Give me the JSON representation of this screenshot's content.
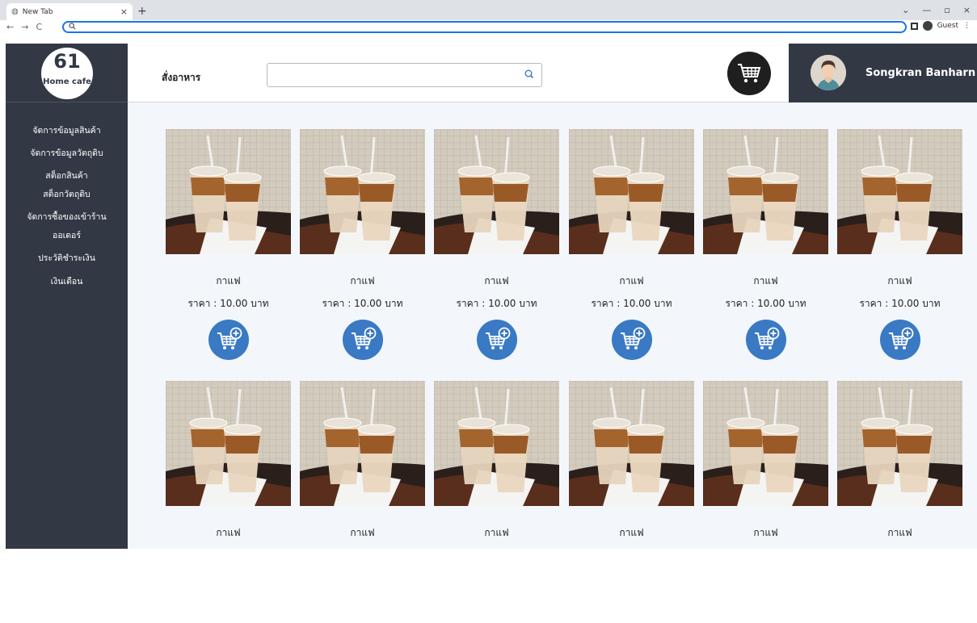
{
  "browser": {
    "tab_title": "New Tab",
    "tab_close": "×",
    "new_tab": "+",
    "nav_back": "←",
    "nav_forward": "→",
    "nav_reload": "C",
    "omnibox_icon": "search-icon",
    "profile_label": "Guest",
    "menu": "⋮",
    "win_min": "—",
    "win_max": "▫",
    "win_close": "×",
    "chevron": "⌄"
  },
  "sidebar": {
    "logo_number": "61",
    "logo_text": "Home cafe",
    "menu": [
      "จัดการข้อมูลสินค้า",
      "จัดการข้อมูลวัตถุดิบ",
      "สต็อกสินค้า",
      "สต็อกวัตถุดิบ",
      "จัดการซื้อของเข้าร้าน",
      "ออเดอร์",
      "ประวัติชำระเงิน",
      "เงินเดือน"
    ]
  },
  "header": {
    "title": "สั่งอาหาร",
    "search_value": "",
    "search_placeholder": "",
    "cart_icon": "cart-icon",
    "user_name": "Songkran Banharn"
  },
  "products": [
    {
      "name": "กาแฟ",
      "price": "ราคา : 10.00 บาท"
    },
    {
      "name": "กาแฟ",
      "price": "ราคา : 10.00 บาท"
    },
    {
      "name": "กาแฟ",
      "price": "ราคา : 10.00 บาท"
    },
    {
      "name": "กาแฟ",
      "price": "ราคา : 10.00 บาท"
    },
    {
      "name": "กาแฟ",
      "price": "ราคา : 10.00 บาท"
    },
    {
      "name": "กาแฟ",
      "price": "ราคา : 10.00 บาท"
    },
    {
      "name": "กาแฟ",
      "price": ""
    },
    {
      "name": "กาแฟ",
      "price": ""
    },
    {
      "name": "กาแฟ",
      "price": ""
    },
    {
      "name": "กาแฟ",
      "price": ""
    },
    {
      "name": "กาแฟ",
      "price": ""
    },
    {
      "name": "กาแฟ",
      "price": ""
    }
  ],
  "colors": {
    "sidebar_bg": "#323945",
    "content_bg": "#f3f7fc",
    "add_button": "#3a79c4",
    "cart_button": "#1f1f1f"
  }
}
